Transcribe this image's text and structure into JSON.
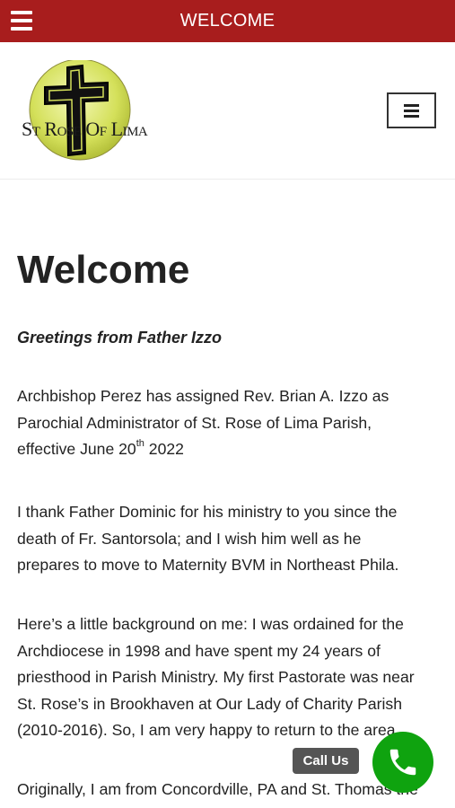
{
  "topbar": {
    "title": "WELCOME",
    "menu_icon": "hamburger-icon",
    "color": "#a81d1d"
  },
  "header": {
    "logo_text": "St Rose Of Lima",
    "menu_icon": "hamburger-icon"
  },
  "main": {
    "heading": "Welcome",
    "greeting": "Greetings from Father Izzo",
    "p1": {
      "line1": "Archbishop Perez has assigned Rev. Brian A. Izzo as",
      "line2": "Parochial Administrator of St. Rose of Lima Parish,",
      "line3_a": "effective June 20",
      "line3_sup": "th",
      "line3_b": " 2022"
    },
    "p2": [
      "I thank Father Dominic for his ministry to you since the",
      "death of Fr. Santorsola; and I wish him well as he",
      "prepares to move to Maternity BVM in Northeast Phila."
    ],
    "p3": [
      "Here’s a little background on me:  I was ordained for the",
      "Archdiocese in 1998 and have spent my 24 years of",
      "priesthood in Parish Ministry. My first Pastorate was near",
      "St. Rose’s in Brookhaven at Our Lady of Charity Parish",
      "(2010-2016).  So, I am very happy to return to the area."
    ],
    "p4": [
      "Originally, I am from Concordville, PA and St. Thomas the"
    ]
  },
  "call": {
    "label": "Call Us",
    "icon": "phone-icon",
    "color": "#0fa30f"
  }
}
